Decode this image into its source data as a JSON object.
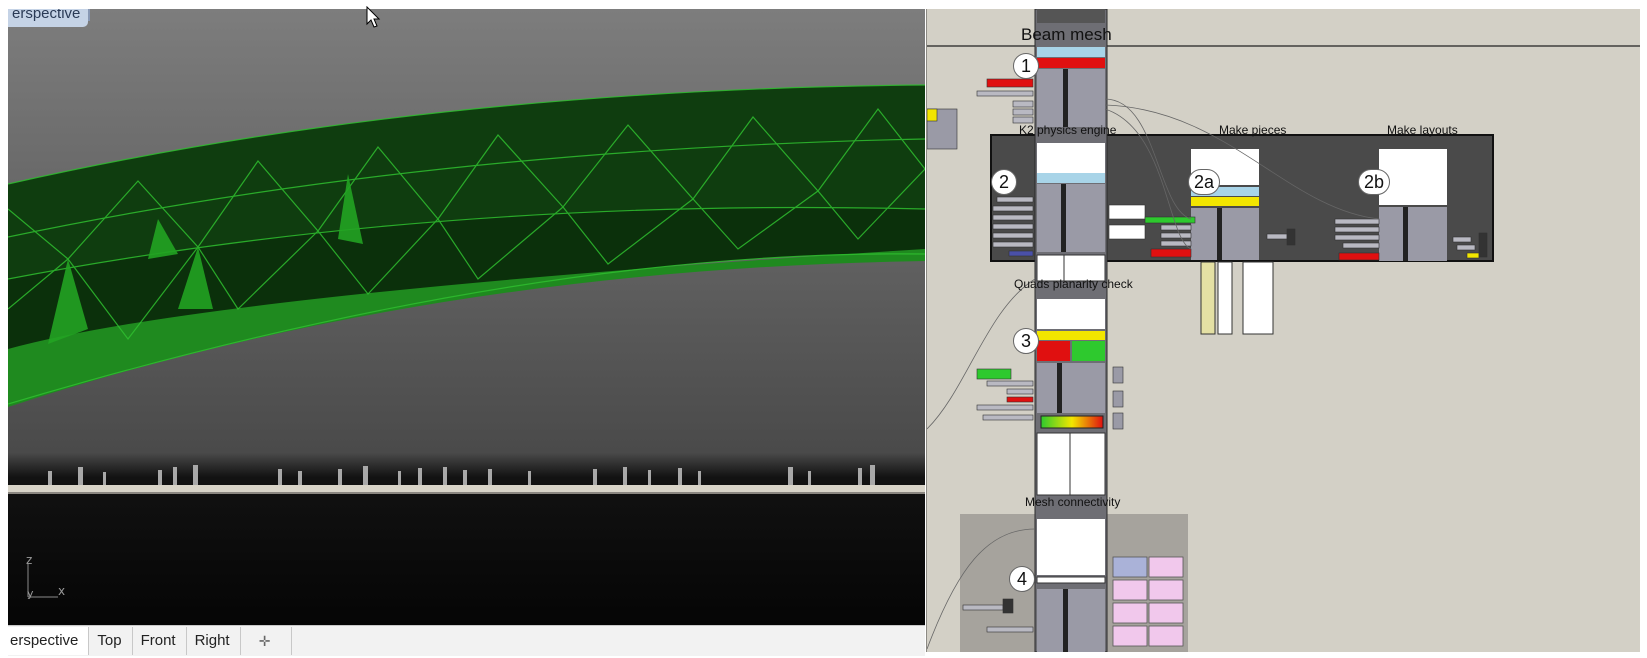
{
  "viewport": {
    "label": "erspective",
    "axes": {
      "z": "z",
      "x": "x",
      "y": "y"
    },
    "tabs": [
      {
        "label": "erspective",
        "active": true
      },
      {
        "label": "Top",
        "active": false
      },
      {
        "label": "Front",
        "active": false
      },
      {
        "label": "Right",
        "active": false
      }
    ],
    "add_tab_icon": "plus-icon",
    "colors": {
      "truss": "#0f3d0f",
      "truss_face": "#1f8a1f",
      "truss_edge": "#2fbf2f",
      "sky_top": "#7c7c7c",
      "ground": "#0a0a0a"
    }
  },
  "canvas": {
    "title": "Beam mesh",
    "groups": {
      "k2": "K2 physics engine",
      "pieces": "Make pieces",
      "layouts": "Make layouts",
      "planarity": "Quads planarity check",
      "connectivity": "Mesh connectivity"
    },
    "badges": {
      "b1": "1",
      "b2": "2",
      "b2a": "2a",
      "b2b": "2b",
      "b3": "3",
      "b4": "4"
    },
    "colors": {
      "background": "#d3d0c6",
      "group_dark": "#4a4a4a",
      "component": "#9a9aa6",
      "highlight_red": "#e01010",
      "highlight_yellow": "#f2e600",
      "highlight_green": "#2ec92e"
    }
  }
}
